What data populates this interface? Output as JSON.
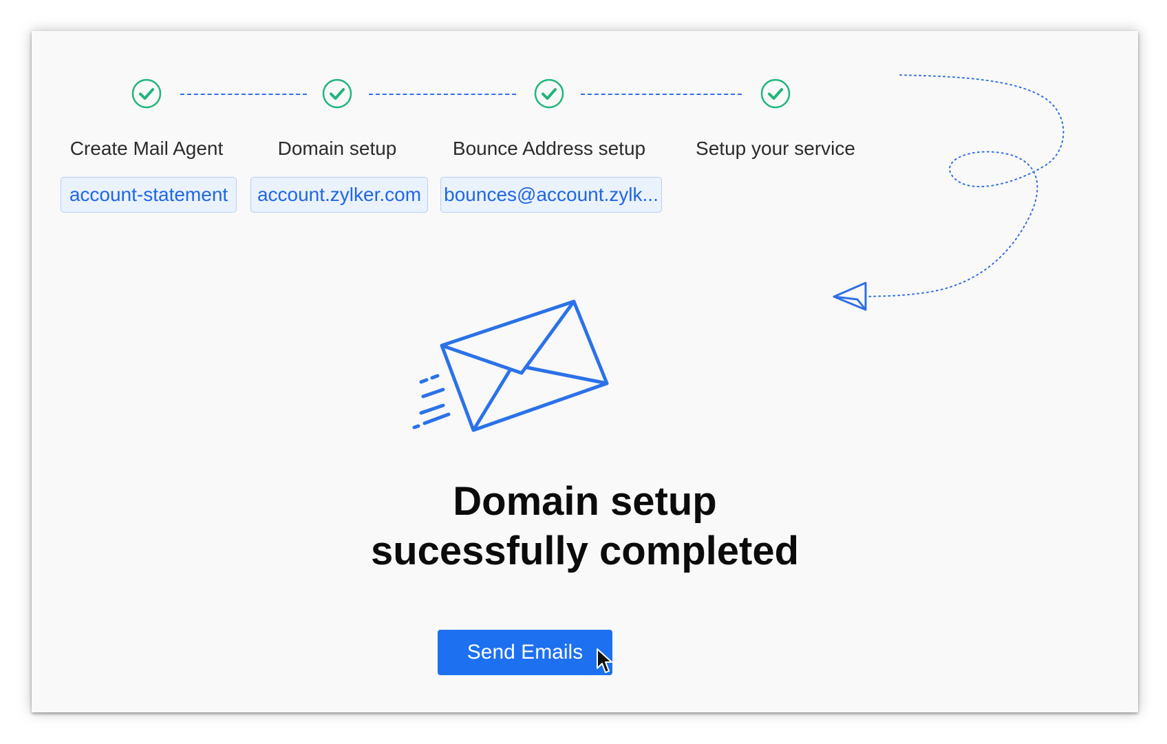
{
  "colors": {
    "accent": "#1d70f0",
    "success": "#1fb57a",
    "chip_bg": "#eaf2fe",
    "chip_text": "#1f66e5"
  },
  "steps": [
    {
      "label": "Create Mail Agent",
      "status": "completed",
      "icon": "check-circle-icon",
      "value": "account-statement"
    },
    {
      "label": "Domain setup",
      "status": "completed",
      "icon": "check-circle-icon",
      "value": "account.zylker.com"
    },
    {
      "label": "Bounce Address setup",
      "status": "completed",
      "icon": "check-circle-icon",
      "value": "bounces@account.zylk..."
    },
    {
      "label": "Setup your service",
      "status": "completed",
      "icon": "check-circle-icon"
    }
  ],
  "illustration": {
    "icon": "envelope-icon",
    "decoration": "paper-plane-icon"
  },
  "message": {
    "line1": "Domain setup",
    "line2": "sucessfully completed"
  },
  "actions": {
    "send_label": "Send Emails"
  }
}
